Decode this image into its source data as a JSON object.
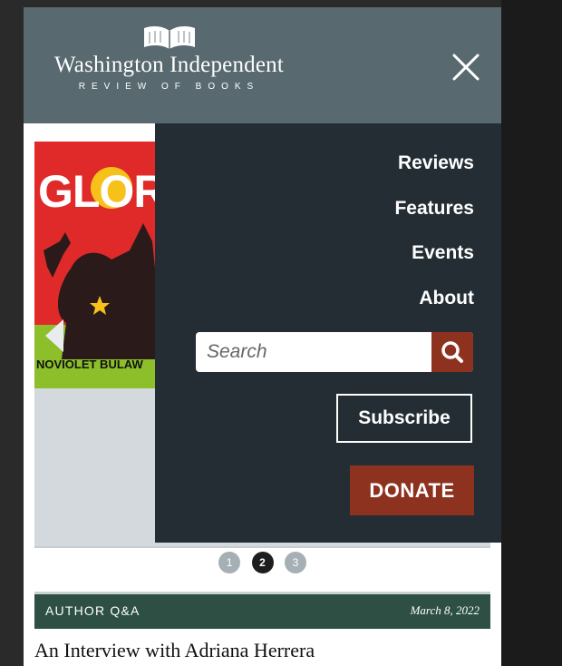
{
  "header": {
    "logo_title": "Washington Independent",
    "logo_subtitle": "REVIEW OF BOOKS",
    "logo_icon": "open-book-icon",
    "close_icon": "close-icon"
  },
  "menu": {
    "items": [
      "Reviews",
      "Features",
      "Events",
      "About"
    ],
    "search_placeholder": "Search",
    "search_icon": "search-icon",
    "subscribe_label": "Subscribe",
    "donate_label": "DONATE"
  },
  "carousel": {
    "cover_title": "GLOR",
    "cover_author": "NOVIOLET BULAW",
    "dots": [
      "1",
      "2",
      "3"
    ],
    "active_dot": "2"
  },
  "article": {
    "category": "AUTHOR Q&A",
    "date": "March 8, 2022",
    "title": "An Interview with Adriana Herrera"
  },
  "colors": {
    "header_bg": "#58696f",
    "menu_bg": "#232d33",
    "accent_red": "#8e3220",
    "category_green": "#2d4f44"
  }
}
